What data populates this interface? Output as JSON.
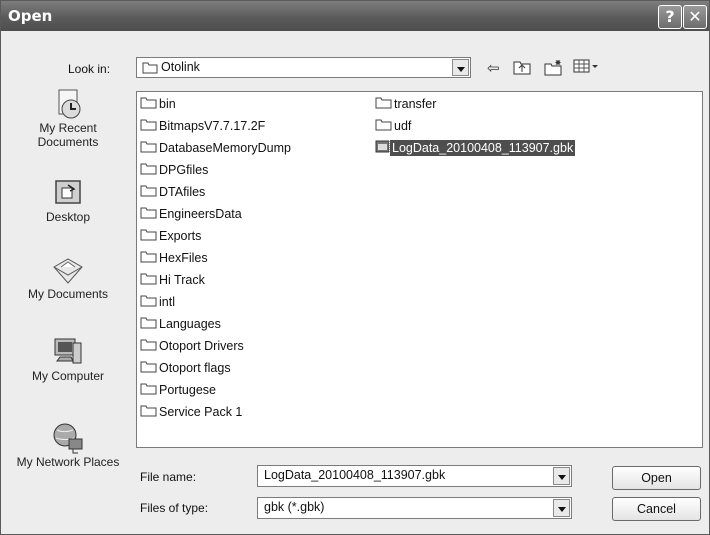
{
  "window": {
    "title": "Open"
  },
  "lookin": {
    "label": "Look in:",
    "value": "Otolink"
  },
  "toolbar": {
    "icons": [
      "back-arrow-icon",
      "up-folder-icon",
      "new-folder-icon",
      "views-menu-icon"
    ]
  },
  "places": [
    {
      "label": "My Recent Documents",
      "icon": "recent-documents-icon"
    },
    {
      "label": "Desktop",
      "icon": "desktop-icon"
    },
    {
      "label": "My Documents",
      "icon": "my-documents-icon"
    },
    {
      "label": "My Computer",
      "icon": "my-computer-icon"
    },
    {
      "label": "My Network Places",
      "icon": "network-places-icon"
    }
  ],
  "files": {
    "column1": [
      "bin",
      "BitmapsV7.7.17.2F",
      "DatabaseMemoryDump",
      "DPGfiles",
      "DTAfiles",
      "EngineersData",
      "Exports",
      "HexFiles",
      "Hi Track",
      "intl",
      "Languages",
      "Otoport Drivers",
      "Otoport flags",
      "Portugese",
      "Service Pack 1"
    ],
    "column2": [
      {
        "name": "transfer",
        "type": "folder"
      },
      {
        "name": "udf",
        "type": "folder"
      },
      {
        "name": "LogData_20100408_113907.gbk",
        "type": "file",
        "selected": true
      }
    ]
  },
  "filename": {
    "label": "File name:",
    "value": "LogData_20100408_113907.gbk"
  },
  "filetype": {
    "label": "Files of type:",
    "value": "gbk (*.gbk)"
  },
  "buttons": {
    "open": "Open",
    "cancel": "Cancel"
  },
  "titlebar_buttons": {
    "help": "?",
    "close": "✕"
  }
}
